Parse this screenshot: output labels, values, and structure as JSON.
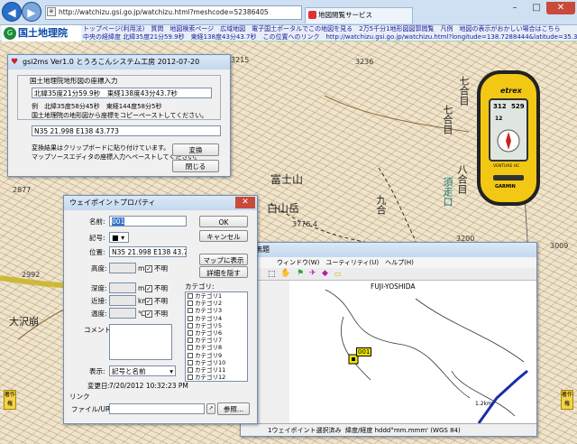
{
  "browser": {
    "address": "http://watchizu.gsi.go.jp/watchizu.html?meshcode=52386405",
    "tab_title": "地図閲覧サービス",
    "back_glyph": "◀",
    "forward_glyph": "▶",
    "min_glyph": "–",
    "max_glyph": "□",
    "close_glyph": "✕"
  },
  "site": {
    "logo_text": "国土地理院",
    "logo_mark": "G",
    "links": "トップページ(利用法)　質問　地図検索ページ　広域地図　電子国土ポータルでこの地図を見る　2万5千分1地形図図郭閲覧　凡例　地図の表示がおかしい場合はこちら",
    "coords": "中央の経緯度 北緯35度21分59.9秒　東経138度43分43.7秒　この位置へのリンク　http://watchizu.gsi.go.jp/watchizu.html?longitude=138.7288444&latitude=35.366611"
  },
  "map_labels": {
    "fuji": "富士山",
    "hakusan": "白山岳",
    "shichigome_a": "七合目",
    "shichigome_b": "七合目",
    "hachigo": "八合目",
    "suzaka": "須走口",
    "kugo": "九合",
    "osawa": "大沢崩",
    "n3236": "3236",
    "n3215": "3215",
    "n3200": "3200",
    "n3776": "3776.4",
    "n2877": "2877",
    "n2992": "2992",
    "n3009": "3009",
    "copyright": "著作権"
  },
  "gps_device": {
    "brand": "etrex",
    "readout_a": "312",
    "readout_b": "529",
    "readout_c": "12",
    "model": "VENTURE HC",
    "maker": "GARMIN"
  },
  "gsi2ms": {
    "title": "gsi2ms  Ver1.0  とうろこんシステム工房 2012-07-20",
    "group_title": "国土地理院地形図の座標入力",
    "input_value": "北緯35度21分59.9秒　東経138度43分43.7秒",
    "example": "例　北緯35度58分45秒　東経144度58分5秒",
    "hint": "国土地理院の地形図から座標をコピーペーストしてください。",
    "output_value": "N35 21.998 E138 43.773",
    "note1": "変換結果はクリップボードに貼り付けています。",
    "note2": "マップソースエディタの座標入力へペーストしてください。",
    "convert_button": "変換",
    "close_button": "閉じる"
  },
  "waypoint": {
    "title": "ウェイポイントプロパティ",
    "name_label": "名前:",
    "name_value": "001",
    "symbol_label": "記号:",
    "position_label": "位置:",
    "position_value": "N35 21.998 E138 43.773",
    "altitude_label": "高度:",
    "depth_label": "深度:",
    "proximity_label": "近接:",
    "temperature_label": "温度:",
    "unit_m": "m",
    "unit_km": "km",
    "unit_c": "℃",
    "unknown_label": "不明",
    "comment_label": "コメント:",
    "display_label": "表示:",
    "display_value": "記号と名前",
    "modified_label": "変更日:",
    "modified_value": "7/20/2012 10:32:23 PM",
    "link_label": "リンク",
    "file_url_label": "ファイル/URL:",
    "category_label": "カテゴリ:",
    "categories": [
      "カテゴリ1",
      "カテゴリ2",
      "カテゴリ3",
      "カテゴリ4",
      "カテゴリ5",
      "カテゴリ6",
      "カテゴリ7",
      "カテゴリ8",
      "カテゴリ9",
      "カテゴリ10",
      "カテゴリ11",
      "カテゴリ12"
    ],
    "ok_button": "OK",
    "cancel_button": "キャンセル",
    "show_on_map_button": "マップに表示(S)",
    "details_button": "詳細を隠す",
    "browse_button": "参照..."
  },
  "mapsource": {
    "title": "無題",
    "menu": "ウィンドウ(W)　ユーティリティ(U)　ヘルプ(H)",
    "map_title": "FUJI-YOSHIDA",
    "waypoint_label": "001",
    "scale_label": "1.2km",
    "status_left": "1ウェイポイント選択済み",
    "status_right": "緯度/経度 hddd°mm.mmm' (WGS 84)"
  }
}
